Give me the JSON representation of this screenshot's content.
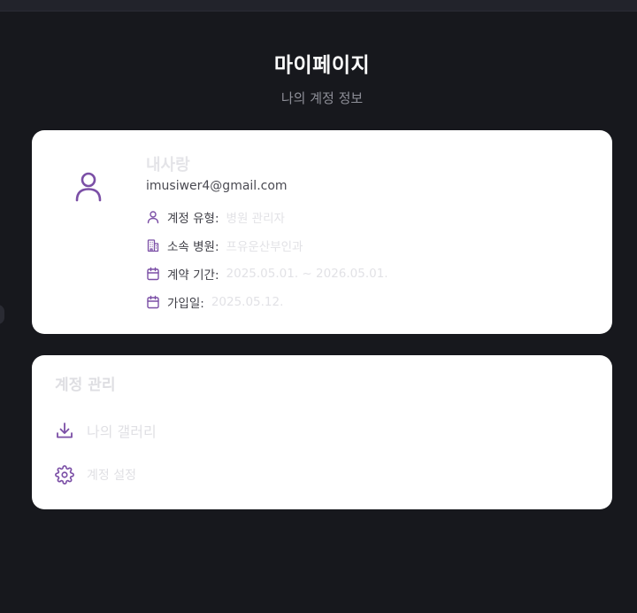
{
  "header": {
    "title": "마이페이지",
    "subtitle": "나의 계정 정보"
  },
  "profile": {
    "name": "내사랑",
    "email": "imusiwer4@gmail.com",
    "fields": [
      {
        "icon": "user-icon",
        "label": "계정 유형:",
        "value": "병원 관리자"
      },
      {
        "icon": "building-icon",
        "label": "소속 병원:",
        "value": "프유운산부인과"
      },
      {
        "icon": "calendar-icon",
        "label": "계약 기간:",
        "value": "2025.05.01. ~ 2026.05.01."
      },
      {
        "icon": "calendar-icon",
        "label": "가입일:",
        "value": "2025.05.12."
      }
    ]
  },
  "account_management": {
    "title": "계정 관리",
    "items": [
      {
        "icon": "download-icon",
        "label": "나의 갤러리"
      },
      {
        "icon": "gear-icon",
        "label": "계정 설정"
      }
    ]
  },
  "colors": {
    "background": "#17181d",
    "card": "#ffffff",
    "accent": "#7b4fa6"
  }
}
